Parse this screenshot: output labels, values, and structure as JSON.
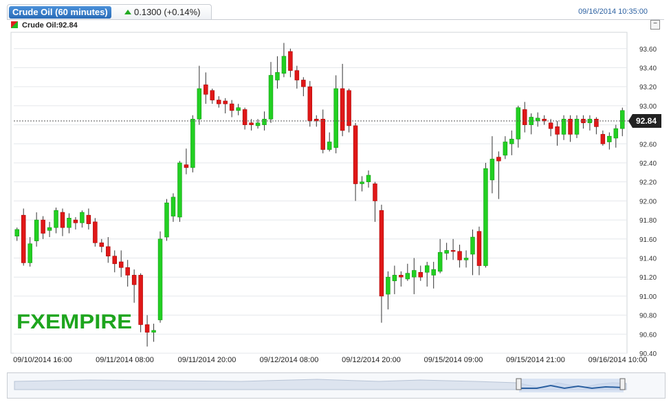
{
  "header": {
    "title": "Crude Oil (60 minutes)",
    "change": "0.1300 (+0.14%)",
    "timestamp": "09/16/2014 10:35:00",
    "legend": "Crude Oil:92.84",
    "minimize_label": "−"
  },
  "watermark": "FXEMPIRE",
  "colors": {
    "up": "#22d022",
    "down": "#e01818",
    "brand_green": "#1ea51e",
    "brand_blue": "#1f77c8"
  },
  "chart_data": {
    "type": "candlestick",
    "ylim": [
      90.4,
      93.75
    ],
    "y_ticks": [
      90.4,
      90.6,
      90.8,
      91.0,
      91.2,
      91.4,
      91.6,
      91.8,
      92.0,
      92.2,
      92.4,
      92.6,
      92.8,
      93.0,
      93.2,
      93.4,
      93.6
    ],
    "x_ticks": [
      "09/10/2014 16:00",
      "09/11/2014 08:00",
      "09/11/2014 20:00",
      "09/12/2014 08:00",
      "09/12/2014 20:00",
      "09/15/2014 09:00",
      "09/15/2014 21:00",
      "09/16/2014 10:00"
    ],
    "last_price": "92.84",
    "candles": [
      [
        91.63,
        91.7,
        91.58,
        91.72
      ],
      [
        91.85,
        91.35,
        91.32,
        91.92
      ],
      [
        91.35,
        91.55,
        91.31,
        91.62
      ],
      [
        91.58,
        91.8,
        91.52,
        91.88
      ],
      [
        91.8,
        91.66,
        91.6,
        91.84
      ],
      [
        91.69,
        91.72,
        91.62,
        91.78
      ],
      [
        91.72,
        91.9,
        91.66,
        91.93
      ],
      [
        91.88,
        91.72,
        91.63,
        91.92
      ],
      [
        91.72,
        91.82,
        91.66,
        91.87
      ],
      [
        91.8,
        91.77,
        91.7,
        91.83
      ],
      [
        91.77,
        91.88,
        91.72,
        91.9
      ],
      [
        91.85,
        91.76,
        91.7,
        91.92
      ],
      [
        91.78,
        91.56,
        91.52,
        91.82
      ],
      [
        91.56,
        91.52,
        91.46,
        91.6
      ],
      [
        91.52,
        91.42,
        91.35,
        91.62
      ],
      [
        91.42,
        91.34,
        91.25,
        91.48
      ],
      [
        91.36,
        91.3,
        91.2,
        91.48
      ],
      [
        91.3,
        91.22,
        91.1,
        91.38
      ],
      [
        91.22,
        91.12,
        90.93,
        91.28
      ],
      [
        91.22,
        90.7,
        90.62,
        91.24
      ],
      [
        90.7,
        90.62,
        90.47,
        90.8
      ],
      [
        90.62,
        90.64,
        90.52,
        90.71
      ],
      [
        90.75,
        91.6,
        90.72,
        91.68
      ],
      [
        91.62,
        91.98,
        91.58,
        92.02
      ],
      [
        91.84,
        92.04,
        91.78,
        92.08
      ],
      [
        91.83,
        92.4,
        91.78,
        92.42
      ],
      [
        92.38,
        92.35,
        92.28,
        92.55
      ],
      [
        92.35,
        92.86,
        92.3,
        92.9
      ],
      [
        92.86,
        93.18,
        92.8,
        93.42
      ],
      [
        93.22,
        93.12,
        93.02,
        93.35
      ],
      [
        93.16,
        93.06,
        93.02,
        93.18
      ],
      [
        93.06,
        93.02,
        92.98,
        93.1
      ],
      [
        93.05,
        93.02,
        92.92,
        93.08
      ],
      [
        93.02,
        92.95,
        92.88,
        93.06
      ],
      [
        92.95,
        92.98,
        92.9,
        93.02
      ],
      [
        92.96,
        92.8,
        92.75,
        92.98
      ],
      [
        92.82,
        92.8,
        92.74,
        92.86
      ],
      [
        92.79,
        92.82,
        92.76,
        92.86
      ],
      [
        92.8,
        92.86,
        92.74,
        92.94
      ],
      [
        92.86,
        93.32,
        92.82,
        93.46
      ],
      [
        93.27,
        93.35,
        93.18,
        93.52
      ],
      [
        93.34,
        93.52,
        93.3,
        93.66
      ],
      [
        93.57,
        93.37,
        93.3,
        93.6
      ],
      [
        93.37,
        93.27,
        93.18,
        93.42
      ],
      [
        93.27,
        93.2,
        93.1,
        93.3
      ],
      [
        93.2,
        92.84,
        92.78,
        93.26
      ],
      [
        92.86,
        92.84,
        92.78,
        92.9
      ],
      [
        92.86,
        92.54,
        92.5,
        92.96
      ],
      [
        92.54,
        92.62,
        92.52,
        92.72
      ],
      [
        92.56,
        93.18,
        92.5,
        93.32
      ],
      [
        93.18,
        92.74,
        92.68,
        93.44
      ],
      [
        93.16,
        92.79,
        92.72,
        93.18
      ],
      [
        92.79,
        92.18,
        92.0,
        92.82
      ],
      [
        92.18,
        92.2,
        92.1,
        92.26
      ],
      [
        92.2,
        92.27,
        92.14,
        92.32
      ],
      [
        92.18,
        92.0,
        91.78,
        92.2
      ],
      [
        91.9,
        91.0,
        90.72,
        91.96
      ],
      [
        91.02,
        91.2,
        90.86,
        91.26
      ],
      [
        91.16,
        91.22,
        91.02,
        91.32
      ],
      [
        91.22,
        91.2,
        91.1,
        91.26
      ],
      [
        91.18,
        91.24,
        91.16,
        91.34
      ],
      [
        91.2,
        91.27,
        91.02,
        91.4
      ],
      [
        91.25,
        91.2,
        91.16,
        91.32
      ],
      [
        91.25,
        91.32,
        91.1,
        91.36
      ],
      [
        91.22,
        91.28,
        91.08,
        91.36
      ],
      [
        91.26,
        91.46,
        91.24,
        91.6
      ],
      [
        91.45,
        91.48,
        91.38,
        91.56
      ],
      [
        91.48,
        91.47,
        91.38,
        91.6
      ],
      [
        91.47,
        91.38,
        91.3,
        91.54
      ],
      [
        91.38,
        91.4,
        91.3,
        91.48
      ],
      [
        91.44,
        91.62,
        91.22,
        91.7
      ],
      [
        91.68,
        91.32,
        91.22,
        91.73
      ],
      [
        91.32,
        92.34,
        91.3,
        92.4
      ],
      [
        92.22,
        92.44,
        92.08,
        92.68
      ],
      [
        92.46,
        92.42,
        92.02,
        92.52
      ],
      [
        92.48,
        92.62,
        92.44,
        92.68
      ],
      [
        92.6,
        92.65,
        92.48,
        92.74
      ],
      [
        92.65,
        92.98,
        92.56,
        93.0
      ],
      [
        92.96,
        92.8,
        92.72,
        93.04
      ],
      [
        92.8,
        92.88,
        92.7,
        92.92
      ],
      [
        92.84,
        92.87,
        92.78,
        92.93
      ],
      [
        92.86,
        92.84,
        92.8,
        92.9
      ],
      [
        92.82,
        92.76,
        92.68,
        92.86
      ],
      [
        92.78,
        92.7,
        92.58,
        92.84
      ],
      [
        92.7,
        92.86,
        92.64,
        92.9
      ],
      [
        92.86,
        92.7,
        92.62,
        92.9
      ],
      [
        92.7,
        92.86,
        92.66,
        92.9
      ],
      [
        92.86,
        92.82,
        92.76,
        92.9
      ],
      [
        92.82,
        92.86,
        92.74,
        92.9
      ],
      [
        92.86,
        92.78,
        92.7,
        92.88
      ],
      [
        92.7,
        92.6,
        92.58,
        92.74
      ],
      [
        92.62,
        92.68,
        92.54,
        92.72
      ],
      [
        92.66,
        92.76,
        92.56,
        92.8
      ],
      [
        92.76,
        92.95,
        92.68,
        92.98
      ]
    ]
  }
}
